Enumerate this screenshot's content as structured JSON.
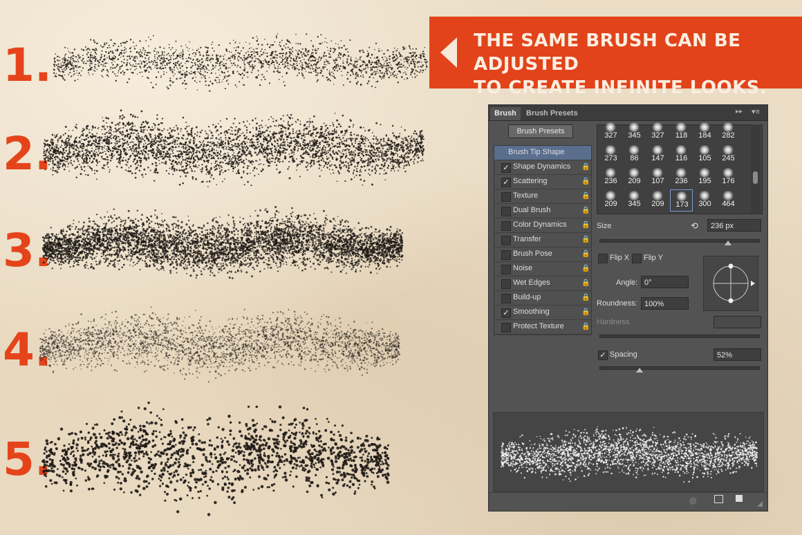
{
  "banner": {
    "line1": "THE SAME BRUSH CAN BE ADJUSTED",
    "line2": "TO CREATE INFINITE LOOKS."
  },
  "examples": [
    {
      "label": "1."
    },
    {
      "label": "2."
    },
    {
      "label": "3."
    },
    {
      "label": "4."
    },
    {
      "label": "5."
    }
  ],
  "colors": {
    "accent": "#e2431a",
    "ink": "#1e1a16",
    "panel": "#535353",
    "selected": "#5a6e8e"
  },
  "panel": {
    "tabs": [
      "Brush",
      "Brush Presets"
    ],
    "presets_button": "Brush Presets",
    "options": [
      {
        "label": "Brush Tip Shape",
        "checked": false,
        "selected": true,
        "checkbox": false
      },
      {
        "label": "Shape Dynamics",
        "checked": true
      },
      {
        "label": "Scattering",
        "checked": true
      },
      {
        "label": "Texture",
        "checked": false
      },
      {
        "label": "Dual Brush",
        "checked": false
      },
      {
        "label": "Color Dynamics",
        "checked": false
      },
      {
        "label": "Transfer",
        "checked": false
      },
      {
        "label": "Brush Pose",
        "checked": false
      },
      {
        "label": "Noise",
        "checked": false
      },
      {
        "label": "Wet Edges",
        "checked": false
      },
      {
        "label": "Build-up",
        "checked": false
      },
      {
        "label": "Smoothing",
        "checked": true
      },
      {
        "label": "Protect Texture",
        "checked": false
      }
    ],
    "presets": [
      "327",
      "345",
      "327",
      "118",
      "184",
      "282",
      "273",
      "86",
      "147",
      "116",
      "105",
      "245",
      "236",
      "209",
      "107",
      "236",
      "195",
      "176",
      "209",
      "345",
      "209",
      "173",
      "300",
      "464"
    ],
    "selected_preset_index": 21,
    "size_label": "Size",
    "size_value": "236 px",
    "size_level": 0.81,
    "flip_x": "Flip X",
    "flip_y": "Flip Y",
    "angle_label": "Angle:",
    "angle_value": "0°",
    "roundness_label": "Roundness:",
    "roundness_value": "100%",
    "hardness_label": "Hardness",
    "spacing_label": "Spacing",
    "spacing_checked": true,
    "spacing_value": "52%",
    "spacing_level": 0.25
  }
}
